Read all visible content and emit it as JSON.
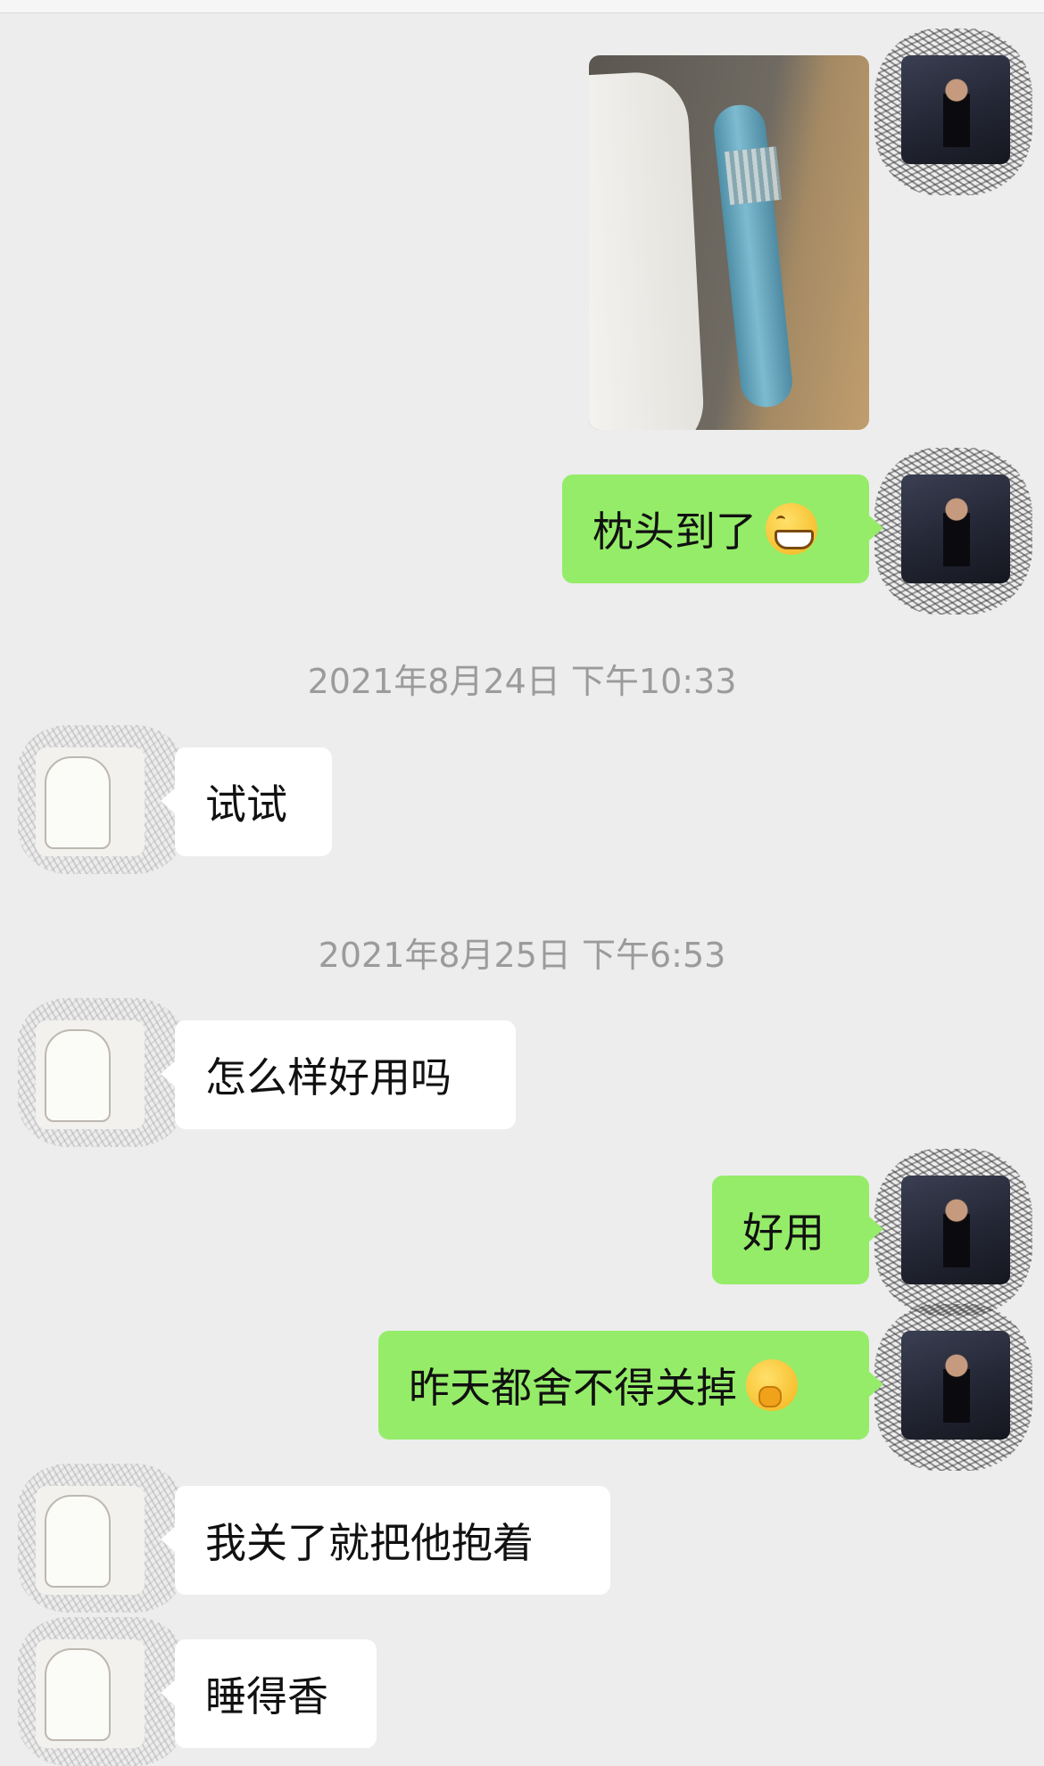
{
  "messages": [
    {
      "sender": "me",
      "type": "image"
    },
    {
      "sender": "me",
      "type": "text",
      "text": "枕头到了",
      "emoji": "grinning-face"
    },
    {
      "type": "timestamp",
      "text": "2021年8月24日 下午10:33"
    },
    {
      "sender": "them",
      "type": "text",
      "text": "试试"
    },
    {
      "type": "timestamp",
      "text": "2021年8月25日 下午6:53"
    },
    {
      "sender": "them",
      "type": "text",
      "text": "怎么样好用吗"
    },
    {
      "sender": "me",
      "type": "text",
      "text": "好用"
    },
    {
      "sender": "me",
      "type": "text",
      "text": "昨天都舍不得关掉",
      "emoji": "thinking-face"
    },
    {
      "sender": "them",
      "type": "text",
      "text": "我关了就把他抱着"
    },
    {
      "sender": "them",
      "type": "text",
      "text": "睡得香"
    }
  ],
  "colors": {
    "background": "#ededed",
    "outgoing_bubble": "#95ec69",
    "incoming_bubble": "#ffffff",
    "timestamp_text": "#9b9b9b"
  },
  "icons": {
    "grin_emoji": "grinning-face",
    "think_emoji": "thinking-face"
  }
}
